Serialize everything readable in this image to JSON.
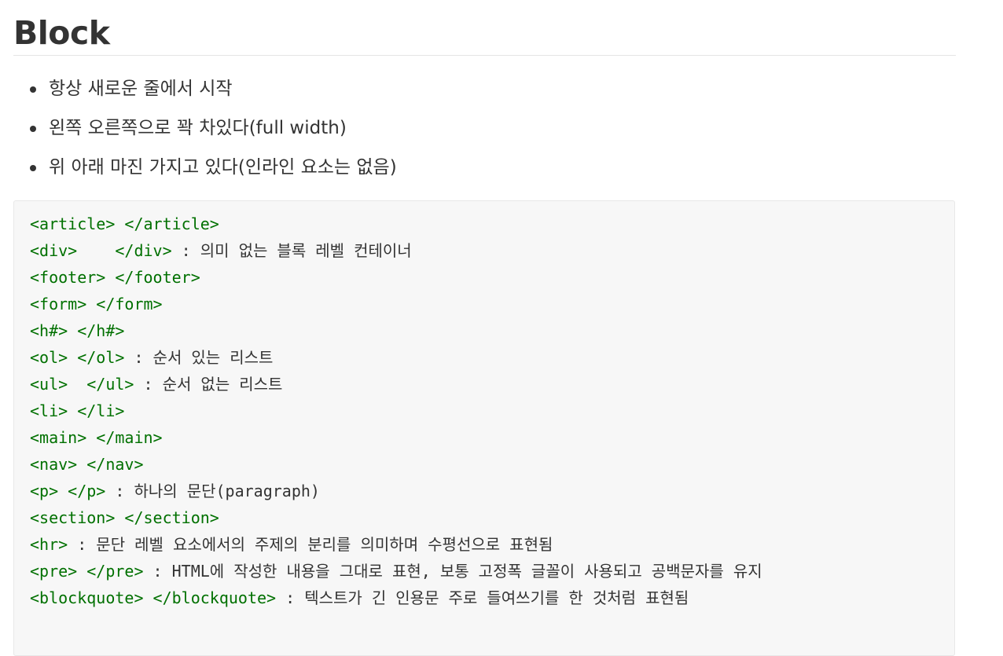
{
  "heading": "Block",
  "bullets": [
    "항상 새로운 줄에서 시작",
    "왼쪽 오른쪽으로 꽉 차있다(full width)",
    "위 아래 마진 가지고 있다(인라인 요소는 없음)"
  ],
  "code_lines": [
    {
      "tag": "<article> </article>",
      "desc": ""
    },
    {
      "tag": "<div>    </div>",
      "desc": " : 의미 없는 블록 레벨 컨테이너"
    },
    {
      "tag": "<footer> </footer>",
      "desc": ""
    },
    {
      "tag": "<form> </form>",
      "desc": ""
    },
    {
      "tag": "<h#> </h#>",
      "desc": ""
    },
    {
      "tag": "<ol> </ol>",
      "desc": " : 순서 있는 리스트"
    },
    {
      "tag": "<ul>  </ul>",
      "desc": " : 순서 없는 리스트"
    },
    {
      "tag": "<li> </li>",
      "desc": ""
    },
    {
      "tag": "<main> </main>",
      "desc": ""
    },
    {
      "tag": "<nav> </nav>",
      "desc": ""
    },
    {
      "tag": "<p> </p>",
      "desc": " : 하나의 문단(paragraph)"
    },
    {
      "tag": "<section> </section>",
      "desc": ""
    },
    {
      "tag": "<hr>",
      "desc": " : 문단 레벨 요소에서의 주제의 분리를 의미하며 수평선으로 표현됨"
    },
    {
      "tag": "<pre> </pre>",
      "desc": " : HTML에 작성한 내용을 그대로 표현, 보통 고정폭 글꼴이 사용되고 공백문자를 유지"
    },
    {
      "tag": "<blockquote> </blockquote>",
      "desc": " : 텍스트가 긴 인용문 주로 들여쓰기를 한 것처럼 표현됨"
    }
  ],
  "colors": {
    "text": "#333333",
    "tag": "#007000",
    "code_bg": "#f7f7f7",
    "rule": "#e5e5e5"
  }
}
